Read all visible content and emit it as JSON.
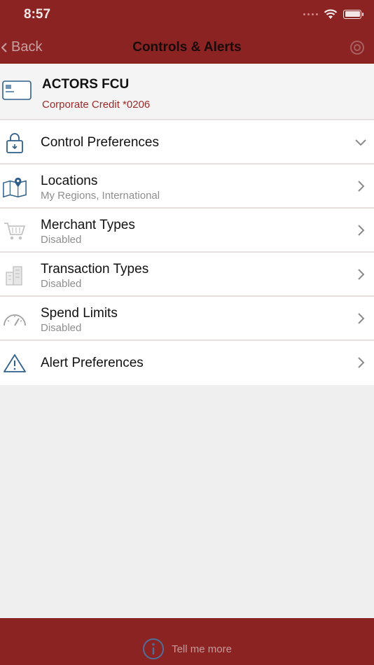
{
  "status": {
    "time": "8:57"
  },
  "nav": {
    "back_label": "Back",
    "title": "Controls & Alerts"
  },
  "card": {
    "name": "ACTORS FCU",
    "subtitle": "Corporate Credit *0206"
  },
  "rows": [
    {
      "label": "Control Preferences",
      "icon": "lock-icon",
      "chevron": "chevron-down-icon"
    },
    {
      "label": "Locations",
      "sub": "My Regions, International",
      "icon": "map-pin-icon",
      "chevron": "chevron-right-icon"
    },
    {
      "label": "Merchant Types",
      "sub": "Disabled",
      "icon": "cart-icon",
      "chevron": "chevron-right-icon"
    },
    {
      "label": "Transaction Types",
      "sub": "Disabled",
      "icon": "buildings-icon",
      "chevron": "chevron-right-icon"
    },
    {
      "label": "Spend Limits",
      "sub": "Disabled",
      "icon": "gauge-icon",
      "chevron": "chevron-right-icon"
    },
    {
      "label": "Alert Preferences",
      "icon": "warning-icon",
      "chevron": "chevron-right-icon"
    }
  ],
  "footer": {
    "label": "Tell me more",
    "icon": "info-icon"
  },
  "colors": {
    "brand": "#8b2323",
    "accent_text": "#9a2a2a",
    "icon_blue": "#2f5f8a"
  }
}
